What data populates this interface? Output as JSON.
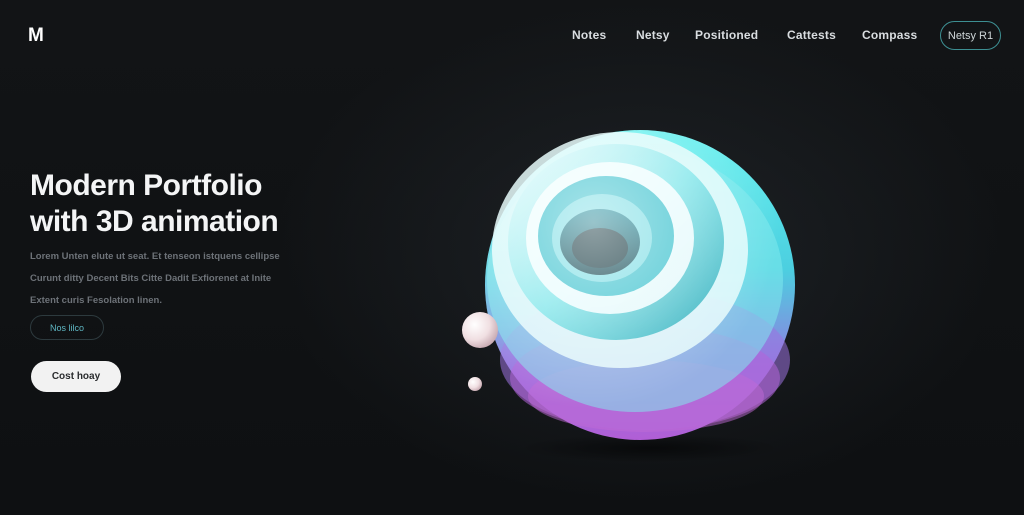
{
  "header": {
    "logo": "M",
    "nav": [
      "Notes",
      "Netsy",
      "Positioned",
      "Cattests",
      "Compass"
    ],
    "cta": "Netsy  R1"
  },
  "hero": {
    "title_lines": [
      "Modern Portfolio",
      "with 3D animation"
    ],
    "description_lines": [
      "Lorem  Unten  elute  ut  seat.  Et  tenseon  istquens  cellipse",
      "Curunt  ditty  Decent  Bits  Citte  Dadit  Exfiorenet  at  Inite",
      "Extent  curis  Fesolation  linen."
    ],
    "outline_button": "Nos  lilco",
    "solid_button": "Cost  hoay"
  },
  "colors": {
    "background": "#0f1114",
    "accent": "#3d8f92",
    "accent_text": "#5fb7c3",
    "sphere_top": "#4fe3e6",
    "sphere_bottom": "#a25ad6"
  },
  "icons": {
    "hero_art": "3d-swirl-sphere",
    "orb_large": "pearl-orb",
    "orb_small": "pearl-orb"
  }
}
